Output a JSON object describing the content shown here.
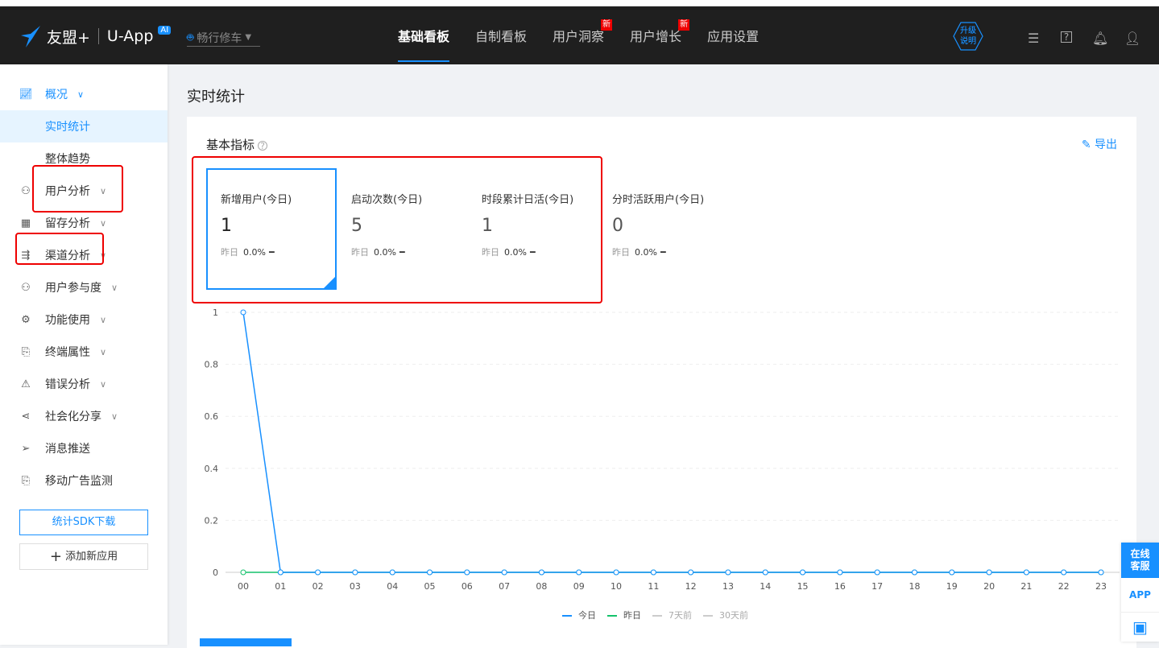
{
  "header": {
    "brand": "友盟+",
    "product": "U-App",
    "ai_badge": "AI",
    "app_name": "畅行修车",
    "nav": [
      {
        "label": "基础看板",
        "active": true
      },
      {
        "label": "自制看板"
      },
      {
        "label": "用户洞察",
        "badge": "新"
      },
      {
        "label": "用户增长",
        "badge": "新"
      },
      {
        "label": "应用设置"
      }
    ],
    "upgrade": "升级说明",
    "upgrade_l1": "升级",
    "upgrade_l2": "说明"
  },
  "sidebar": {
    "items": [
      {
        "label": "概况"
      },
      {
        "label": "实时统计"
      },
      {
        "label": "整体趋势"
      },
      {
        "label": "用户分析"
      },
      {
        "label": "留存分析"
      },
      {
        "label": "渠道分析"
      },
      {
        "label": "用户参与度"
      },
      {
        "label": "功能使用"
      },
      {
        "label": "终端属性"
      },
      {
        "label": "错误分析"
      },
      {
        "label": "社会化分享"
      },
      {
        "label": "消息推送"
      },
      {
        "label": "移动广告监测"
      }
    ],
    "sdk_button": "统计SDK下载",
    "add_app": "添加新应用"
  },
  "page": {
    "title": "实时统计",
    "card_title": "基本指标",
    "export": "导出"
  },
  "metrics": [
    {
      "label": "新增用户(今日)",
      "value": "1",
      "y_label": "昨日",
      "change": "0.0%"
    },
    {
      "label": "启动次数(今日)",
      "value": "5",
      "y_label": "昨日",
      "change": "0.0%"
    },
    {
      "label": "时段累计日活(今日)",
      "value": "1",
      "y_label": "昨日",
      "change": "0.0%"
    },
    {
      "label": "分时活跃用户(今日)",
      "value": "0",
      "y_label": "昨日",
      "change": "0.0%"
    }
  ],
  "chart_data": {
    "type": "line",
    "x": [
      "00",
      "01",
      "02",
      "03",
      "04",
      "05",
      "06",
      "07",
      "08",
      "09",
      "10",
      "11",
      "12",
      "13",
      "14",
      "15",
      "16",
      "17",
      "18",
      "19",
      "20",
      "21",
      "22",
      "23"
    ],
    "yticks": [
      "0",
      "0.2",
      "0.4",
      "0.6",
      "0.8",
      "1"
    ],
    "ylim": [
      0,
      1
    ],
    "series": [
      {
        "name": "今日",
        "color": "#1890ff",
        "values": [
          1,
          0,
          0,
          0,
          0,
          0,
          0,
          0,
          0,
          0,
          0,
          0,
          0,
          0,
          0,
          0,
          0,
          0,
          0,
          0,
          0,
          0,
          0,
          0
        ]
      },
      {
        "name": "昨日",
        "color": "#13c26b",
        "values": [
          0,
          0,
          0,
          0,
          0,
          0,
          0,
          0,
          0,
          0,
          0,
          0,
          0,
          0,
          0,
          0,
          0,
          0,
          0,
          0,
          0,
          0,
          0,
          0
        ]
      }
    ],
    "legend": [
      {
        "name": "今日",
        "color": "#1890ff"
      },
      {
        "name": "昨日",
        "color": "#13c26b"
      },
      {
        "name": "7天前",
        "color": "#ccc"
      },
      {
        "name": "30天前",
        "color": "#ccc"
      }
    ]
  },
  "float": {
    "service_l1": "在线",
    "service_l2": "客服",
    "app": "APP"
  }
}
